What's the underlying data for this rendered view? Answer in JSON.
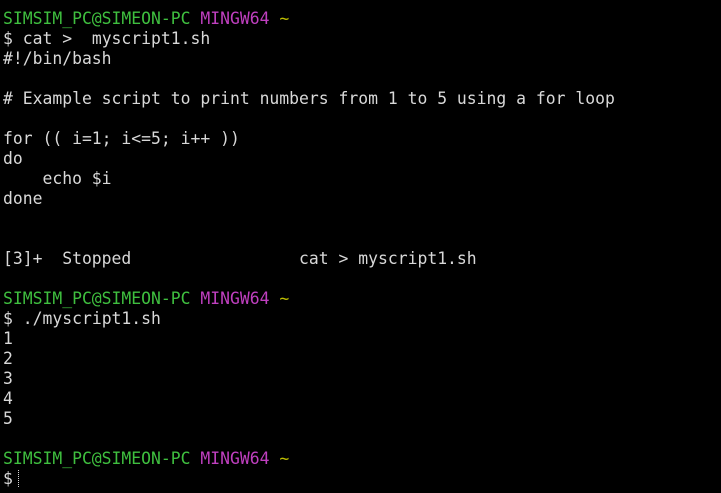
{
  "prompt": {
    "user_host": "SIMSIM_PC@SIMEON-PC",
    "shell": "MINGW64",
    "cwd": "~",
    "symbol": "$"
  },
  "commands": {
    "cat": "cat >  myscript1.sh",
    "run": "./myscript1.sh"
  },
  "script_lines": [
    "#!/bin/bash",
    "",
    "# Example script to print numbers from 1 to 5 using a for loop",
    "",
    "for (( i=1; i<=5; i++ ))",
    "do",
    "    echo $i",
    "done"
  ],
  "job_message": "[3]+  Stopped                 cat > myscript1.sh",
  "output_lines": [
    "1",
    "2",
    "3",
    "4",
    "5"
  ]
}
